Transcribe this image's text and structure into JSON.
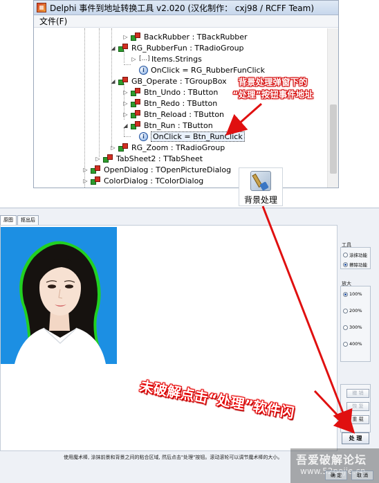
{
  "tool_window": {
    "title": "Delphi 事件到地址转换工具 v2.020 (汉化制作： cxj98 / RCFF Team)",
    "menu_file": "文件(F)"
  },
  "tree": {
    "rows": [
      {
        "label": "BackRubber : TBackRubber"
      },
      {
        "label": "RG_RubberFun : TRadioGroup"
      },
      {
        "label": "Items.Strings"
      },
      {
        "label": "OnClick = RG_RubberFunClick"
      },
      {
        "label": "GB_Operate : TGroupBox"
      },
      {
        "label": "Btn_Undo : TButton"
      },
      {
        "label": "Btn_Redo : TButton"
      },
      {
        "label": "Btn_Reload : TButton"
      },
      {
        "label": "Btn_Run : TButton"
      },
      {
        "label": "OnClick = Btn_RunClick"
      },
      {
        "label": "RG_Zoom : TRadioGroup"
      },
      {
        "label": "TabSheet2 : TTabSheet"
      },
      {
        "label": "OpenDialog : TOpenPictureDialog"
      },
      {
        "label": "ColorDialog : TColorDialog"
      }
    ]
  },
  "annotations": {
    "top_line1": "背景处理弹窗下的",
    "top_line2": "“处理”按钮事件地址",
    "bottom": "未破解点击“处理”软件闪"
  },
  "bg_button": {
    "icon": "brush-icon",
    "label": "背景处理"
  },
  "app": {
    "tabs": [
      "原图",
      "抠出后"
    ],
    "tool_group": {
      "title": "工具",
      "options": [
        "涂抹功能",
        "擦除功能"
      ],
      "selected": 1
    },
    "zoom_group": {
      "title": "放大",
      "options": [
        "100%",
        "200%",
        "300%",
        "400%"
      ],
      "selected": 0
    },
    "buttons": {
      "undo": "撤 销",
      "redo": "恢 复",
      "reset": "重 载",
      "process": "处 理"
    },
    "status_text": "使用魔术棒, 涂抹前景和背景之间的粘合区域, 然后点击\"处理\"按钮。滚动滚轮可以调节魔术棒的大小。",
    "bottom_buttons": [
      "确 定",
      "取 消"
    ]
  },
  "watermark": {
    "line1": "吾爱破解论坛",
    "line2": "www.52pojie.cn"
  },
  "colors": {
    "annotation_red": "#e01010",
    "photo_background": "#1c8fe3",
    "outline_green": "#22d022"
  }
}
